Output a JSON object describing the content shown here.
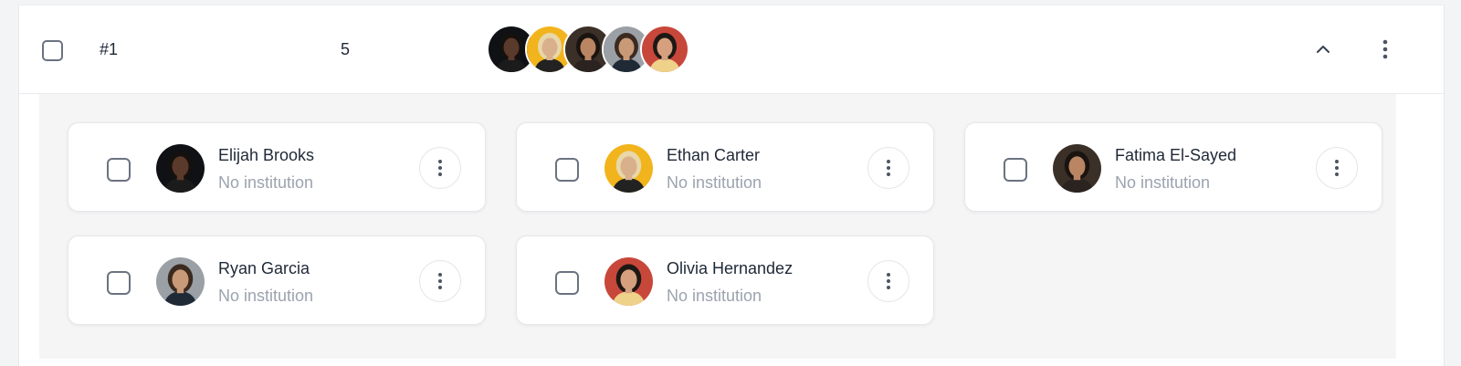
{
  "group": {
    "label": "#1",
    "count": "5",
    "icons": {
      "collapse": "chevron-up-icon",
      "menu": "more-vertical-icon"
    }
  },
  "members": [
    {
      "name": "Elijah Brooks",
      "institution": "No institution",
      "avatar": {
        "bg": "#0f1115",
        "skin": "#5a3a2a",
        "hair": "#14110f",
        "shirt": "#1b1b1b"
      }
    },
    {
      "name": "Ethan Carter",
      "institution": "No institution",
      "avatar": {
        "bg": "#f2b41c",
        "skin": "#d9b08c",
        "hair": "#e8d7a8",
        "shirt": "#222222"
      }
    },
    {
      "name": "Fatima El-Sayed",
      "institution": "No institution",
      "avatar": {
        "bg": "#3b3028",
        "skin": "#b98563",
        "hair": "#1a1410",
        "shirt": "#2a2320"
      }
    },
    {
      "name": "Ryan Garcia",
      "institution": "No institution",
      "avatar": {
        "bg": "#9aa0a6",
        "skin": "#c99a78",
        "hair": "#3b2a20",
        "shirt": "#1f2a36"
      }
    },
    {
      "name": "Olivia Hernandez",
      "institution": "No institution",
      "avatar": {
        "bg": "#c8473b",
        "skin": "#d6a07e",
        "hair": "#1e1814",
        "shirt": "#efd28a"
      }
    }
  ],
  "colors": {
    "checkbox_border": "#6b7280",
    "text_primary": "#1f2937",
    "text_secondary": "#9ca3af"
  }
}
